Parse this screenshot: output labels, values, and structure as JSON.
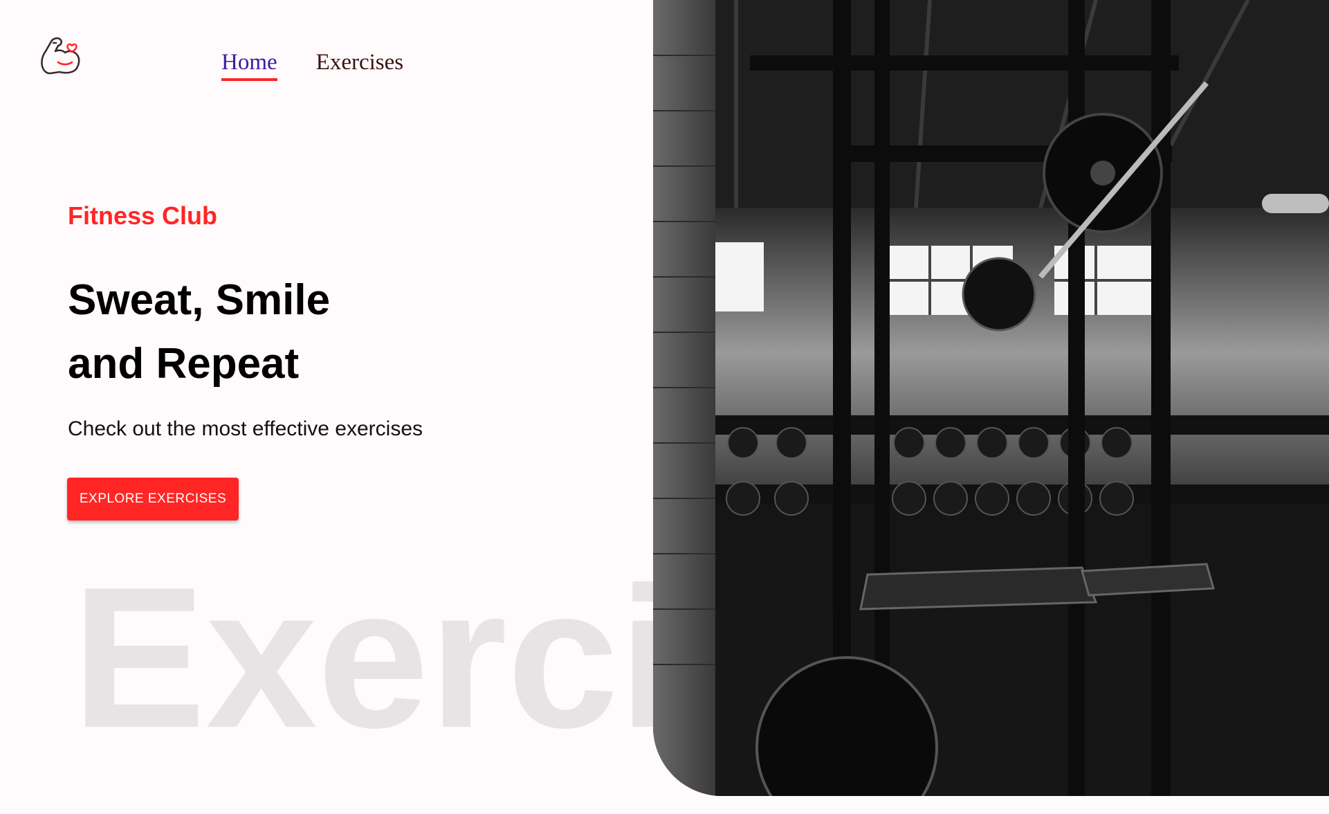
{
  "nav": {
    "home_label": "Home",
    "exercises_label": "Exercises"
  },
  "hero": {
    "eyebrow": "Fitness Club",
    "headline_line1": "Sweat, Smile",
    "headline_line2": "and Repeat",
    "subtitle": "Check out the most effective exercises",
    "cta_label": "EXPLORE EXERCISES",
    "watermark": "Exercise"
  },
  "colors": {
    "accent": "#ff2625",
    "nav_active": "#3a1ea0",
    "background": "#fffafb"
  },
  "icons": {
    "logo": "flexed-arm-heart-icon"
  }
}
